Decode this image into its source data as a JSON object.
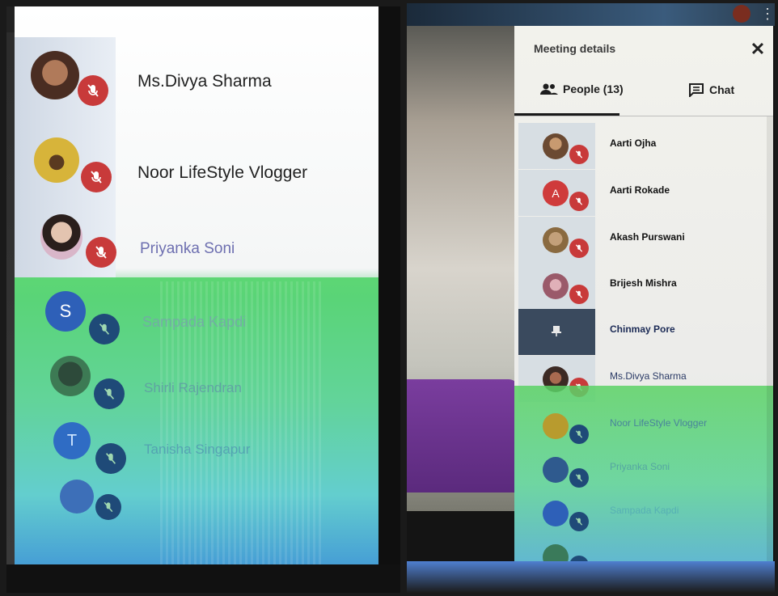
{
  "left": {
    "participants": [
      {
        "name": "Ms.Divya Sharma",
        "avatar_color": "#4a2d22",
        "mic_color": "#c83a3a"
      },
      {
        "name": "Noor LifeStyle Vlogger",
        "avatar_color": "#d7b43a",
        "mic_color": "#c83a3a"
      },
      {
        "name": "Priyanka Soni",
        "avatar_color": "#b7a49c",
        "mic_color": "#c83a3a"
      },
      {
        "name": "Sampada Kapdi",
        "avatar_initial": "S",
        "avatar_color": "#2e60b8",
        "mic_color": "#1f4a78"
      },
      {
        "name": "Shirli Rajendran",
        "avatar_color": "#3d7a54",
        "mic_color": "#1f4a78"
      },
      {
        "name": "Tanisha Singapur",
        "avatar_initial": "T",
        "avatar_color": "#2f6cc4",
        "mic_color": "#1f4a78"
      },
      {
        "name": "",
        "avatar_color": "#3d6fb8",
        "mic_color": "#1f4a78"
      }
    ]
  },
  "right": {
    "header": {
      "title": "Meeting details",
      "close_glyph": "✕"
    },
    "tabs": {
      "people": {
        "label": "People (13)"
      },
      "chat": {
        "label": "Chat"
      }
    },
    "participants": [
      {
        "name": "Aarti Ojha",
        "avatar_color": "#6b4a32",
        "mic_color": "#c83a3a"
      },
      {
        "name": "Aarti Rokade",
        "avatar_initial": "A",
        "avatar_color": "#cf3b3b",
        "mic_color": "#c83a3a"
      },
      {
        "name": "Akash Purswani",
        "avatar_color": "#8a6a40",
        "mic_color": "#c83a3a"
      },
      {
        "name": "Brijesh Mishra",
        "avatar_color": "#9a5a6a",
        "mic_color": "#c83a3a"
      },
      {
        "name": "Chinmay Pore",
        "avatar_color": "#3a4a5e",
        "mic_color": ""
      },
      {
        "name": "Ms.Divya Sharma",
        "avatar_color": "#3c2a24",
        "mic_color": "#c83a3a"
      },
      {
        "name": "Noor LifeStyle Vlogger",
        "avatar_color": "#b89b2e",
        "mic_color": "#1f4a78"
      },
      {
        "name": "Priyanka Soni",
        "avatar_color": "#2f5a8e",
        "mic_color": "#1f4a78"
      },
      {
        "name": "Sampada Kapdi",
        "avatar_color": "#2e60b8",
        "mic_color": "#1f4a78"
      },
      {
        "name": "",
        "avatar_color": "#3a7a5a",
        "mic_color": "#1f4a78"
      }
    ]
  }
}
